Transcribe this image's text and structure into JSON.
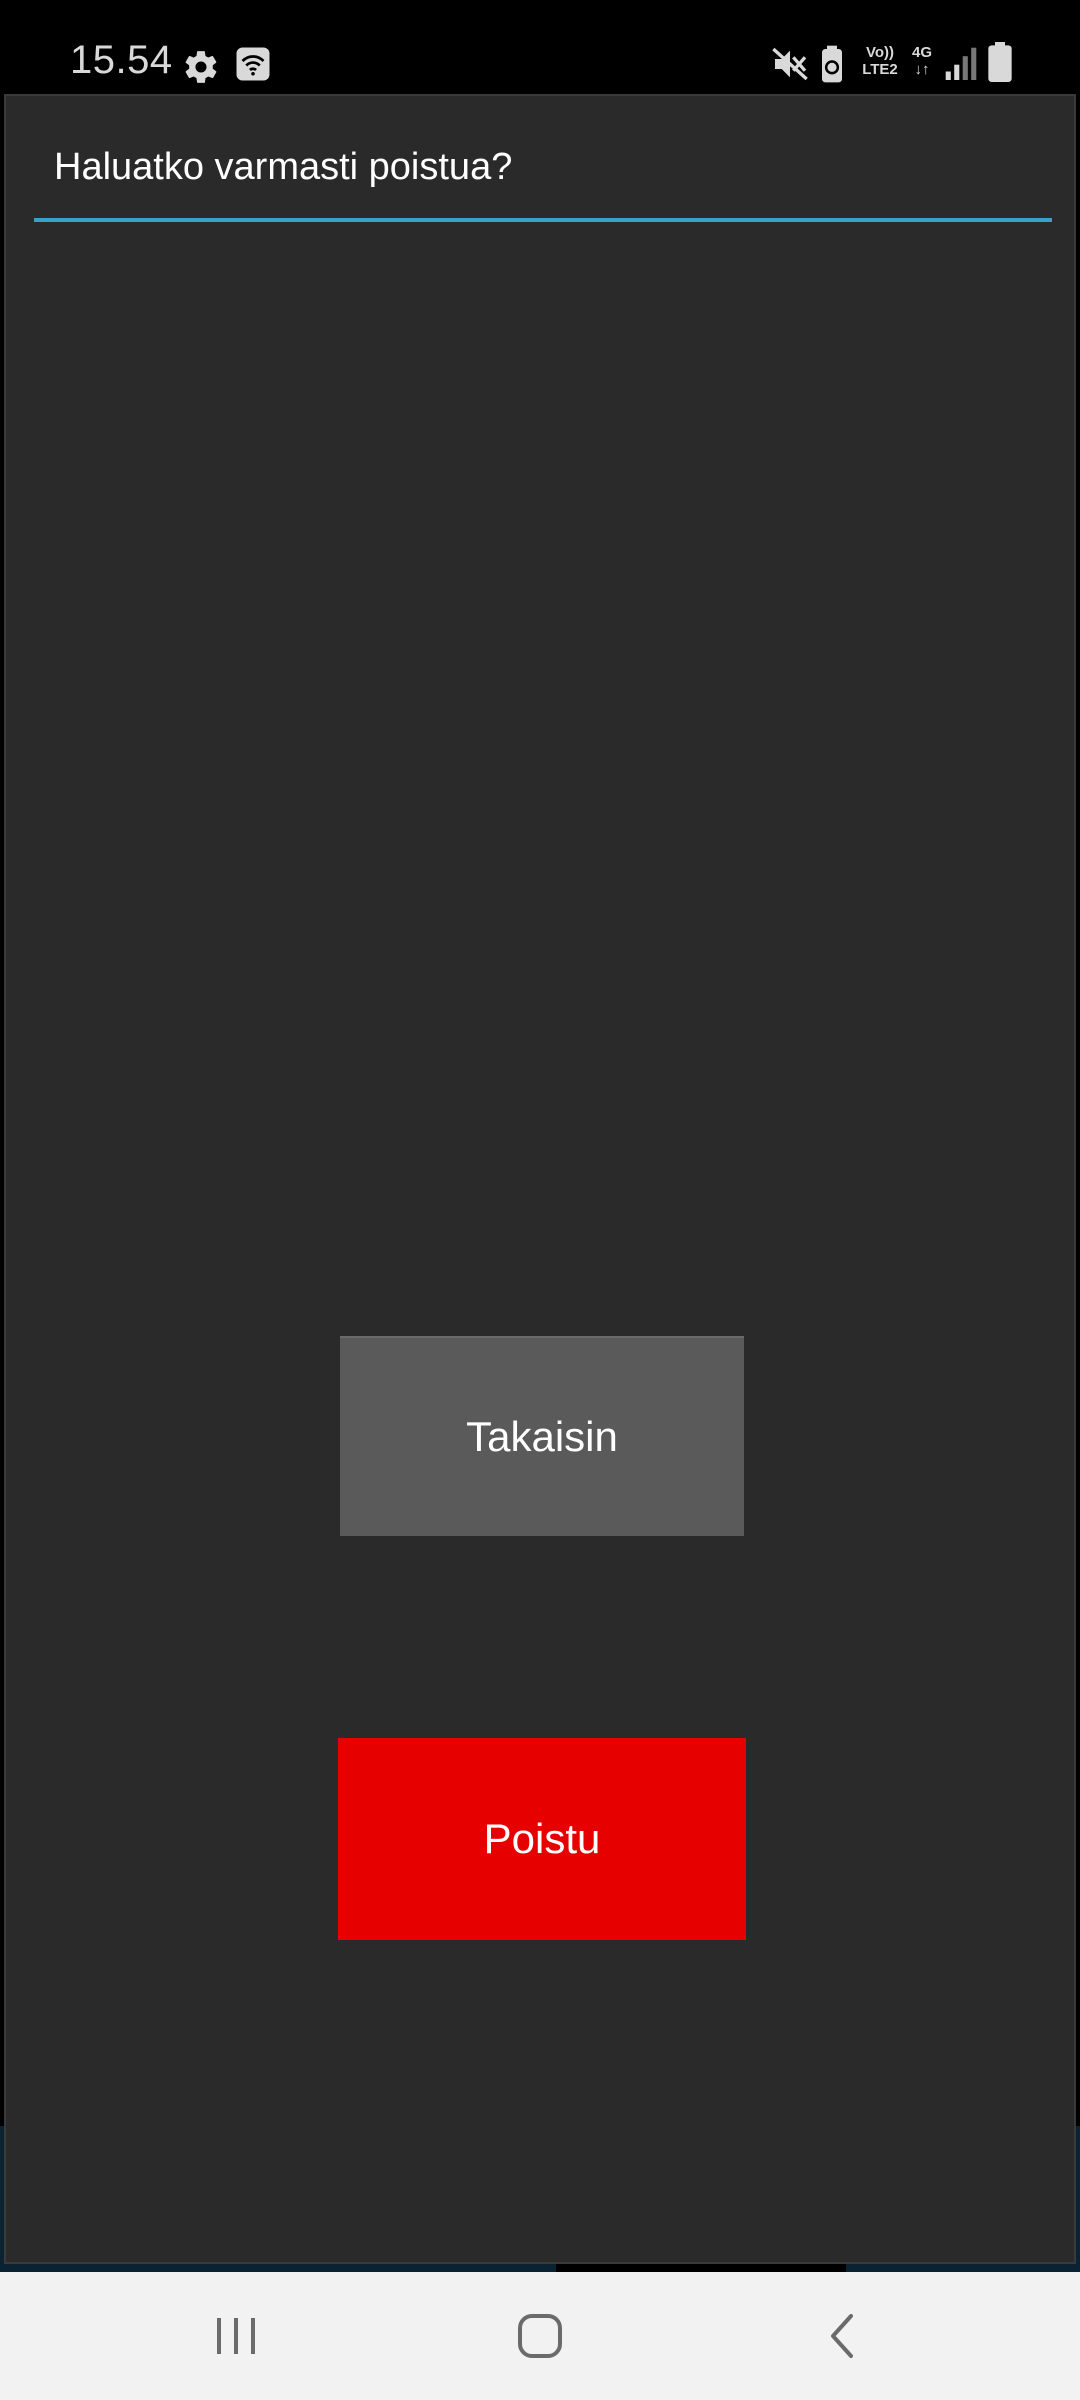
{
  "status_bar": {
    "time": "15.54",
    "icons": [
      "gear-icon",
      "wifi-icon",
      "mute-icon",
      "battery-saver-icon",
      "volte-icon",
      "4g-icon",
      "signal-icon",
      "battery-icon"
    ],
    "volte_line1": "Vo))",
    "volte_line2": "LTE2",
    "network_label": "4G"
  },
  "dialog": {
    "title": "Haluatko varmasti poistua?",
    "divider_color": "#34a3c9",
    "back_button_label": "Takaisin",
    "exit_button_label": "Poistu",
    "exit_button_color": "#e60000",
    "back_button_color": "#5a5a5a"
  },
  "nav_bar": {
    "buttons": [
      "recents-icon",
      "home-icon",
      "back-icon"
    ]
  }
}
